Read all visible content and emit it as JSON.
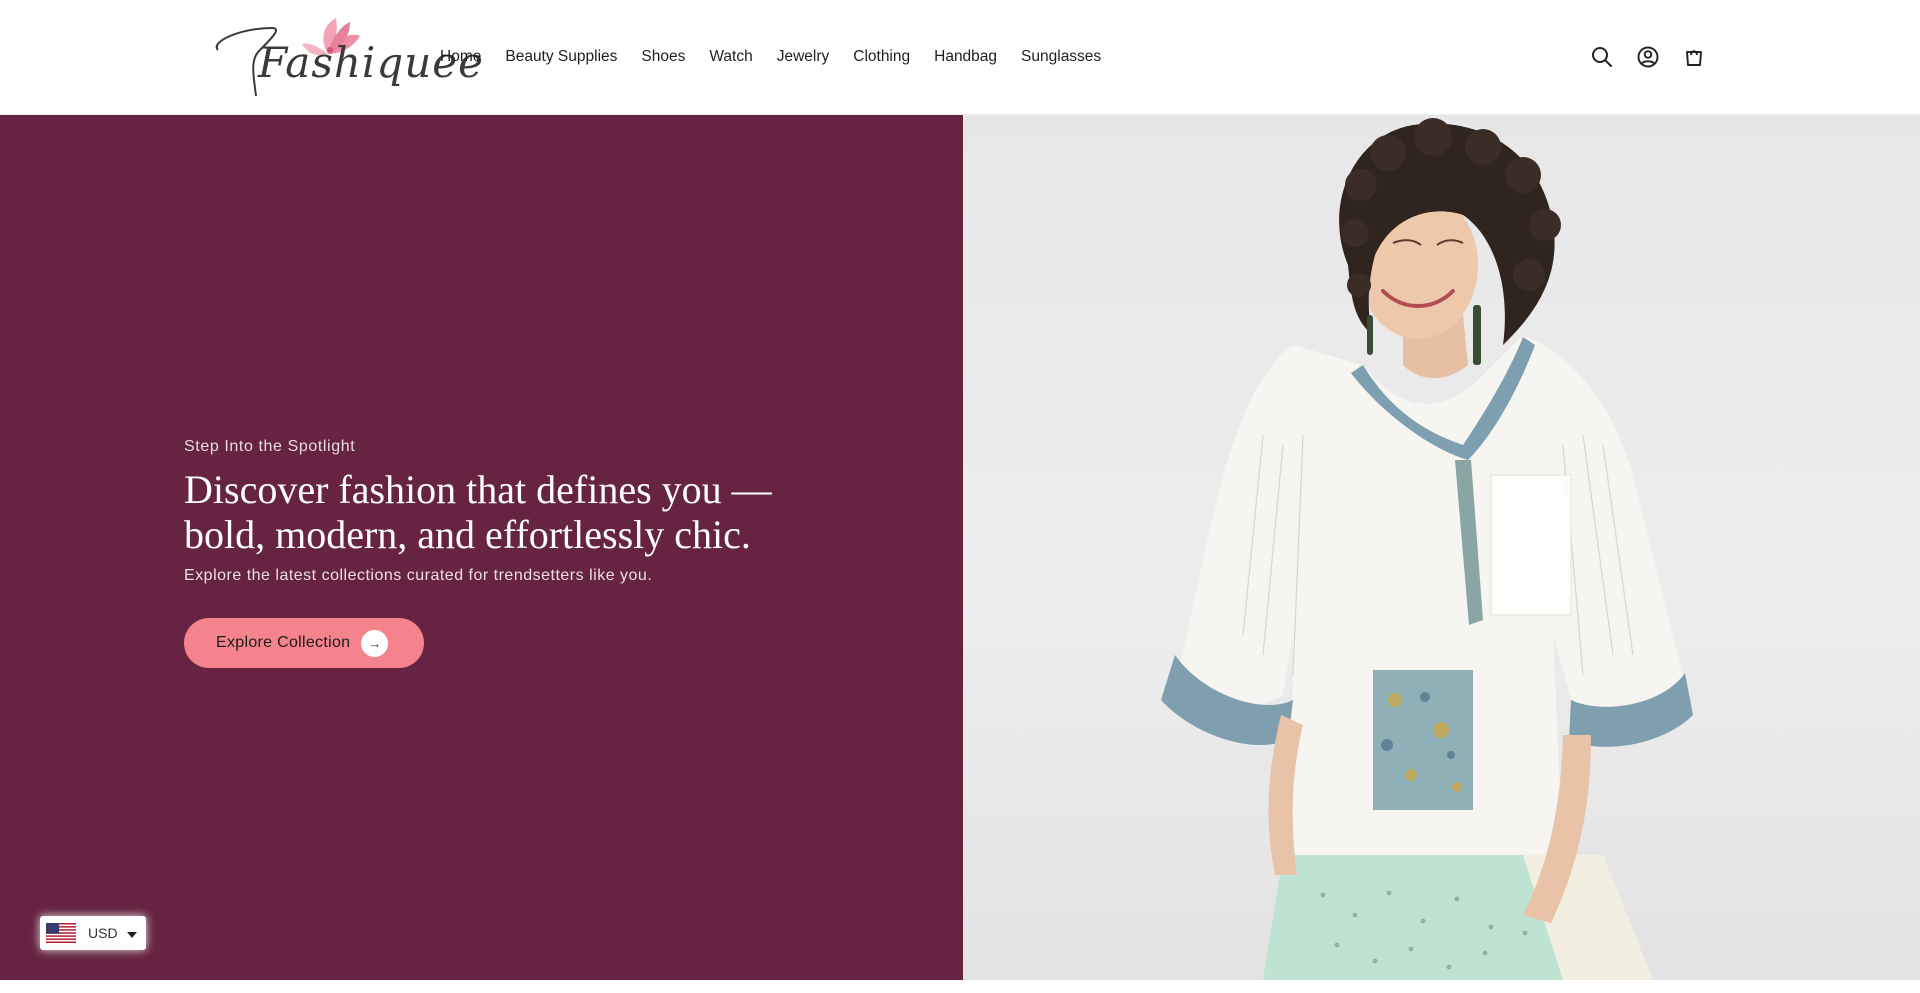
{
  "header": {
    "logo_text": "Fashiquee",
    "nav": [
      {
        "label": "Home"
      },
      {
        "label": "Beauty Supplies"
      },
      {
        "label": "Shoes"
      },
      {
        "label": "Watch"
      },
      {
        "label": "Jewelry"
      },
      {
        "label": "Clothing"
      },
      {
        "label": "Handbag"
      },
      {
        "label": "Sunglasses"
      }
    ],
    "icons": [
      "search-icon",
      "account-icon",
      "cart-icon"
    ]
  },
  "hero": {
    "eyebrow": "Step Into the Spotlight",
    "headline": "Discover fashion that defines you — bold, modern, and effortlessly chic.",
    "subtext": "Explore the latest collections curated for trendsetters like you.",
    "cta_label": "Explore Collection",
    "cta_arrow": "→",
    "panel_color": "#662442",
    "cta_color": "#f5838d"
  },
  "currency": {
    "code": "USD",
    "flag": "us-flag-icon"
  }
}
